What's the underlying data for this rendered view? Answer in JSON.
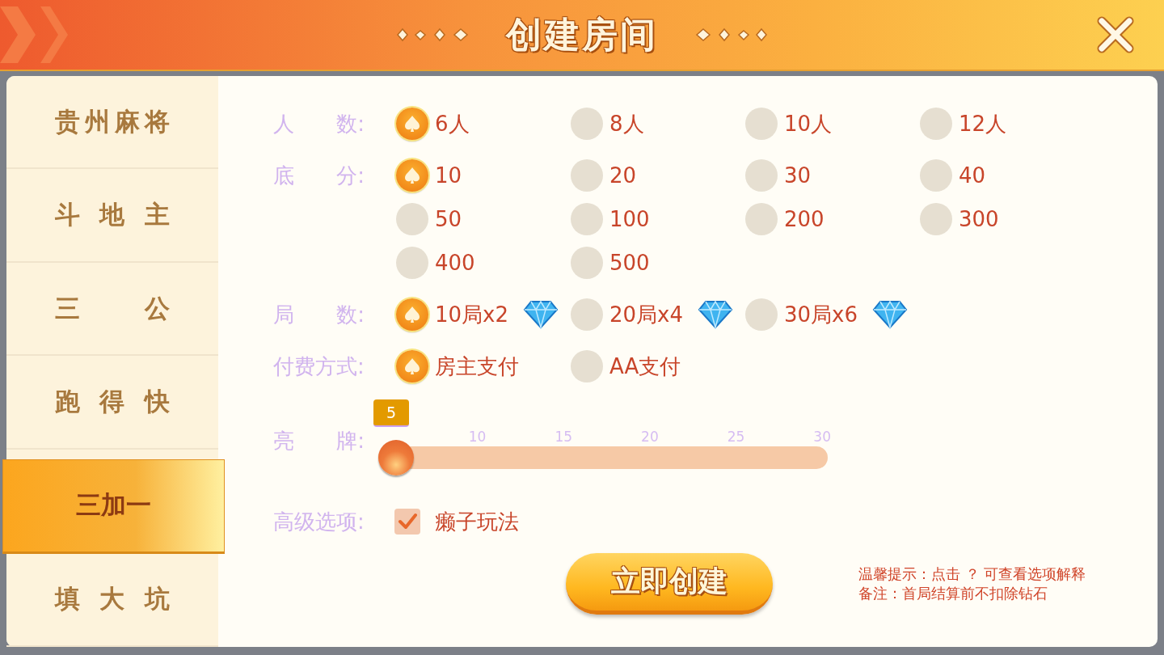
{
  "header": {
    "title": "创建房间"
  },
  "sidebar": {
    "items": [
      {
        "label": "贵州麻将",
        "selected": false
      },
      {
        "label": "斗 地 主",
        "selected": false
      },
      {
        "label": "三 公",
        "selected": false
      },
      {
        "label": "跑 得 快",
        "selected": false
      },
      {
        "label": "三加一",
        "selected": true
      },
      {
        "label": "填 大 坑",
        "selected": false
      }
    ]
  },
  "sections": [
    {
      "kind": "radio",
      "label": "人 数:",
      "options": [
        {
          "label": "6人",
          "selected": true
        },
        {
          "label": "8人",
          "selected": false
        },
        {
          "label": "10人",
          "selected": false
        },
        {
          "label": "12人",
          "selected": false
        }
      ]
    },
    {
      "kind": "radio",
      "label": "底 分:",
      "options": [
        {
          "label": "10",
          "selected": true
        },
        {
          "label": "20",
          "selected": false
        },
        {
          "label": "30",
          "selected": false
        },
        {
          "label": "40",
          "selected": false
        },
        {
          "label": "50",
          "selected": false
        },
        {
          "label": "100",
          "selected": false
        },
        {
          "label": "200",
          "selected": false
        },
        {
          "label": "300",
          "selected": false
        },
        {
          "label": "400",
          "selected": false
        },
        {
          "label": "500",
          "selected": false
        }
      ]
    },
    {
      "kind": "radio_diamond",
      "label": "局 数:",
      "options": [
        {
          "label": "10局x2",
          "selected": true
        },
        {
          "label": "20局x4",
          "selected": false
        },
        {
          "label": "30局x6",
          "selected": false
        }
      ]
    },
    {
      "kind": "radio",
      "label": "付费方式:",
      "options": [
        {
          "label": "房主支付",
          "selected": true
        },
        {
          "label": "AA支付",
          "selected": false
        }
      ]
    },
    {
      "kind": "slider",
      "label": "亮 牌:",
      "value": "5",
      "level": 0,
      "ticks": [
        "10",
        "15",
        "20",
        "25",
        "30"
      ]
    },
    {
      "kind": "checkbox",
      "label": "高级选项:",
      "options": [
        {
          "label": "癞子玩法",
          "checked": true
        }
      ]
    }
  ],
  "create_button": "立即创建",
  "tips": [
    "温馨提示：点击 ？ 可查看选项解释",
    "备注：首局结算前不扣除钻石"
  ]
}
